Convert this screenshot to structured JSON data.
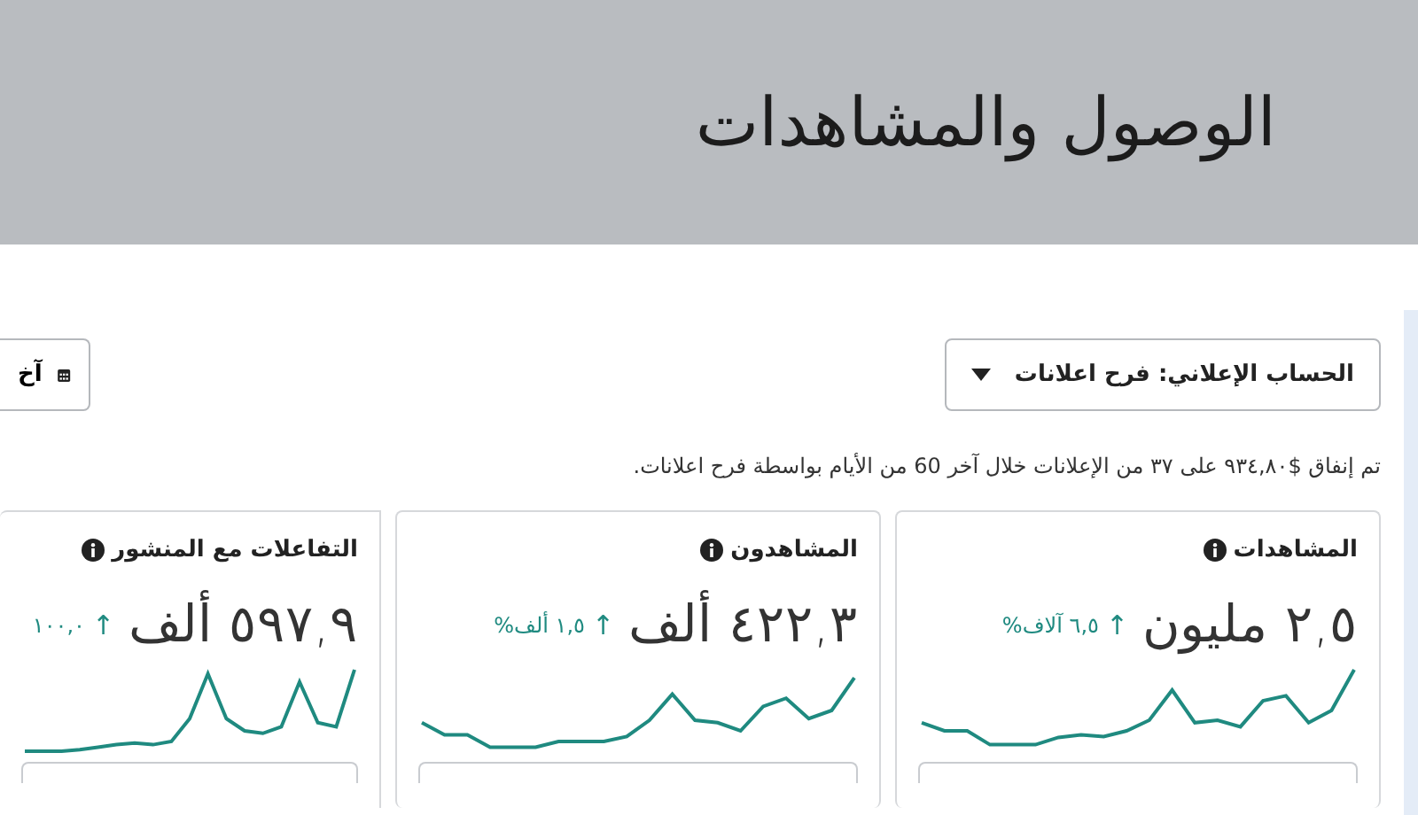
{
  "header": {
    "title": "الوصول والمشاهدات"
  },
  "account_dropdown": {
    "label": "الحساب الإعلاني: فرح اعلانات"
  },
  "date_button": {
    "label": "آخ"
  },
  "summary": "تم إنفاق $٩٣٤,٨٠ على ٣٧ من الإعلانات خلال آخر 60 من الأيام بواسطة فرح اعلانات.",
  "metrics": [
    {
      "title": "المشاهدات",
      "value": "٢,٥ مليون",
      "arrow": "↑",
      "change": "٦,٥ آلاف%"
    },
    {
      "title": "المشاهدون",
      "value": "٤٢٢,٣ ألف",
      "arrow": "↑",
      "change": "١,٥ ألف%"
    },
    {
      "title": "التفاعلات مع المنشور",
      "value": "٥٩٧,٩ ألف",
      "arrow": "↑",
      "change": "١٠٠,٠"
    }
  ]
}
